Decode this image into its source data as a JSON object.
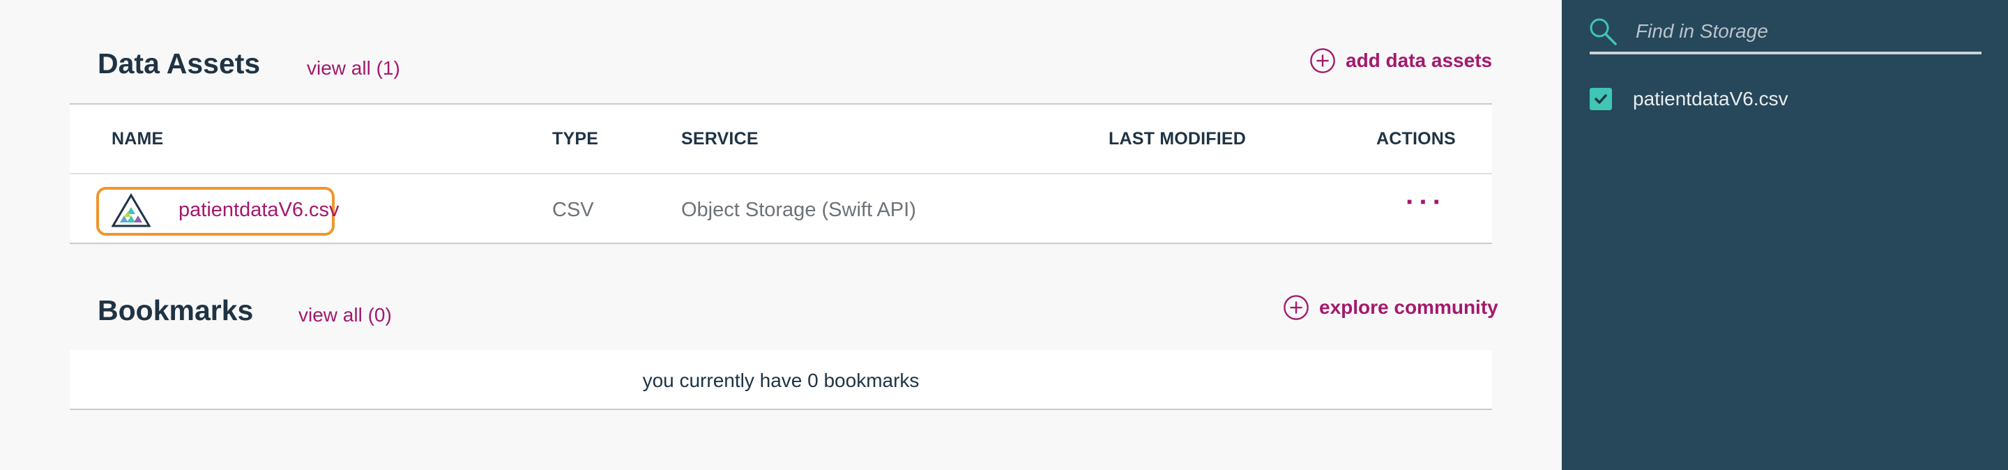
{
  "data_assets": {
    "title": "Data Assets",
    "view_all": "view all (1)",
    "add_label": "add data assets",
    "columns": {
      "name": "NAME",
      "type": "TYPE",
      "service": "SERVICE",
      "last_modified": "LAST MODIFIED",
      "actions": "ACTIONS"
    },
    "rows": [
      {
        "name": "patientdataV6.csv",
        "type": "CSV",
        "service": "Object Storage (Swift API)",
        "last_modified": "",
        "actions": "···"
      }
    ]
  },
  "bookmarks": {
    "title": "Bookmarks",
    "view_all": "view all (0)",
    "add_label": "explore community",
    "empty_message": "you currently have 0 bookmarks"
  },
  "storage_panel": {
    "search_placeholder": "Find in Storage",
    "items": [
      {
        "label": "patientdataV6.csv",
        "checked": true
      }
    ]
  },
  "colors": {
    "accent": "#a3196d",
    "panel": "#27475a",
    "checkbox": "#3fc6b4",
    "highlight": "#f0962e"
  }
}
